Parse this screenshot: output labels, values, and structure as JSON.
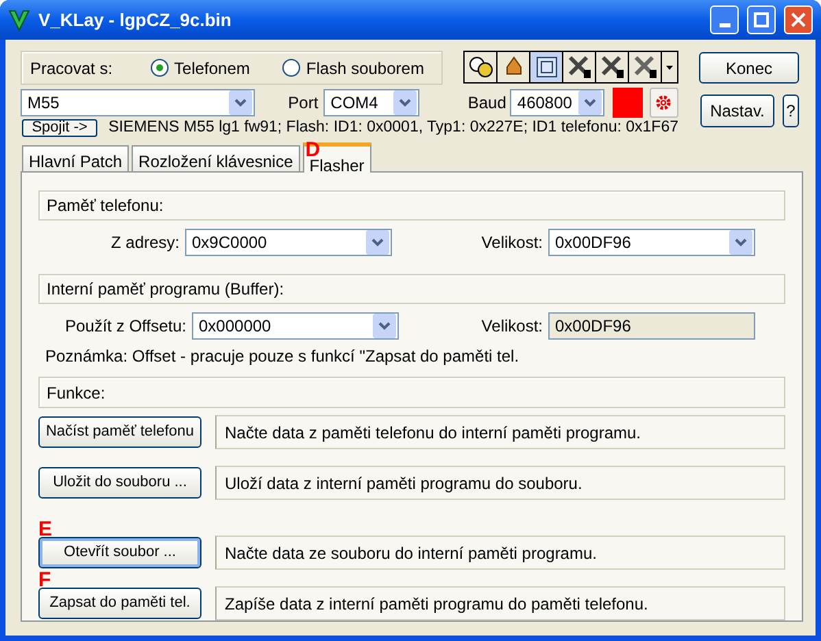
{
  "window": {
    "title": "V_KLay - lgpCZ_9c.bin"
  },
  "work_with": {
    "label": "Pracovat s:",
    "options": [
      {
        "label": "Telefonem",
        "selected": true
      },
      {
        "label": "Flash souborem",
        "selected": false
      }
    ]
  },
  "buttons": {
    "close": "Konec",
    "settings": "Nastav.",
    "help": "?",
    "connect": "Spojit ->"
  },
  "model": {
    "value": "M55"
  },
  "port": {
    "label": "Port",
    "value": "COM4"
  },
  "baud": {
    "label": "Baud",
    "value": "460800",
    "color": "#ff0000"
  },
  "info": "SIEMENS M55 lg1 fw91; Flash: ID1: 0x0001, Typ1: 0x227E; ID1 telefonu: 0x1F67",
  "tabs": [
    {
      "label": "Hlavní Patch",
      "selected": false
    },
    {
      "label": "Rozložení klávesnice",
      "selected": false
    },
    {
      "label": "Flasher",
      "selected": true,
      "marker": "D"
    }
  ],
  "phone_memory": {
    "title": "Paměť telefonu:",
    "address_label": "Z adresy:",
    "address": "0x9C0000",
    "size_label": "Velikost:",
    "size": "0x00DF96"
  },
  "buffer": {
    "title": "Interní paměť programu (Buffer):",
    "offset_label": "Použít z Offsetu:",
    "offset": "0x000000",
    "size_label": "Velikost:",
    "size": "0x00DF96",
    "note": "Poznámka: Offset - pracuje pouze s funkcí \"Zapsat do paměti tel."
  },
  "functions": {
    "title": "Funkce:",
    "items": [
      {
        "button": "Načíst paměť telefonu",
        "description": "Načte data z paměti telefonu do interní paměti programu.",
        "focused": false
      },
      {
        "button": "Uložit do souboru ...",
        "description": "Uloží data z interní paměti programu do souboru.",
        "focused": false
      },
      {
        "button": "Otevřít soubor ...",
        "description": "Načte data ze souboru do interní paměti programu.",
        "focused": true,
        "marker": "E"
      },
      {
        "button": "Zapsat do paměti tel.",
        "description": "Zapíše data z interní paměti programu do paměti telefonu.",
        "focused": false,
        "marker": "F"
      }
    ]
  }
}
